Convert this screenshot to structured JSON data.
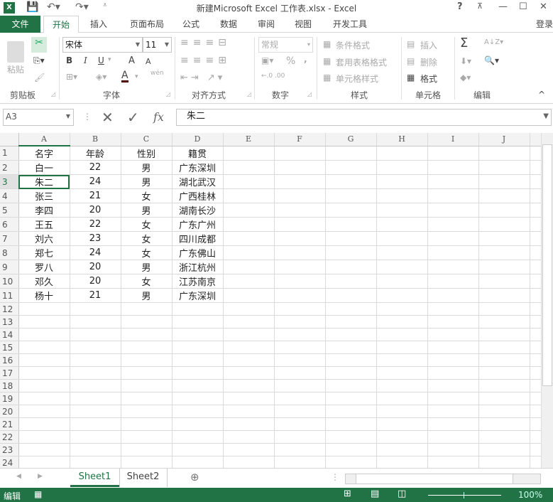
{
  "title": "新建Microsoft Excel 工作表.xlsx - Excel",
  "window_controls": {
    "help": "?",
    "restore_ribbon": "⊼",
    "minimize": "—",
    "maximize": "☐",
    "close": "✕"
  },
  "tabs": [
    "文件",
    "开始",
    "插入",
    "页面布局",
    "公式",
    "数据",
    "审阅",
    "视图",
    "开发工具"
  ],
  "login": "登录",
  "ribbon": {
    "clipboard": {
      "paste": "粘贴",
      "label": "剪贴板"
    },
    "font": {
      "name": "宋体",
      "size": "11",
      "bold": "B",
      "italic": "I",
      "underline": "U",
      "grow": "A",
      "shrink": "A",
      "phonetic": "wén",
      "label": "字体"
    },
    "align": {
      "label": "对齐方式"
    },
    "number": {
      "format": "常规",
      "percent": "%",
      "comma": ",",
      "label": "数字"
    },
    "styles": {
      "conditional": "条件格式",
      "table": "套用表格格式",
      "cell": "单元格样式",
      "label": "样式"
    },
    "cells": {
      "insert": "插入",
      "delete": "删除",
      "format": "格式",
      "label": "单元格"
    },
    "editing": {
      "sum": "Σ",
      "label": "编辑"
    }
  },
  "formula_bar": {
    "name_box": "A3",
    "fx": "fx",
    "value": "朱二"
  },
  "columns": [
    "A",
    "B",
    "C",
    "D",
    "E",
    "F",
    "G",
    "H",
    "I",
    "J"
  ],
  "rows": [
    [
      "名字",
      "年龄",
      "性别",
      "籍贯"
    ],
    [
      "白一",
      "22",
      "男",
      "广东深圳"
    ],
    [
      "朱二",
      "24",
      "男",
      "湖北武汉"
    ],
    [
      "张三",
      "21",
      "女",
      "广西桂林"
    ],
    [
      "李四",
      "20",
      "男",
      "湖南长沙"
    ],
    [
      "王五",
      "22",
      "女",
      "广东广州"
    ],
    [
      "刘六",
      "23",
      "女",
      "四川成都"
    ],
    [
      "郑七",
      "24",
      "女",
      "广东佛山"
    ],
    [
      "罗八",
      "20",
      "男",
      "浙江杭州"
    ],
    [
      "邓久",
      "20",
      "女",
      "江苏南京"
    ],
    [
      "杨十",
      "21",
      "男",
      "广东深圳"
    ]
  ],
  "row_count": 25,
  "selected_cell": "A3",
  "sheets": [
    "Sheet1",
    "Sheet2"
  ],
  "active_sheet": "Sheet1",
  "status": {
    "mode": "编辑",
    "zoom": "100%"
  },
  "colors": {
    "accent": "#217346"
  }
}
